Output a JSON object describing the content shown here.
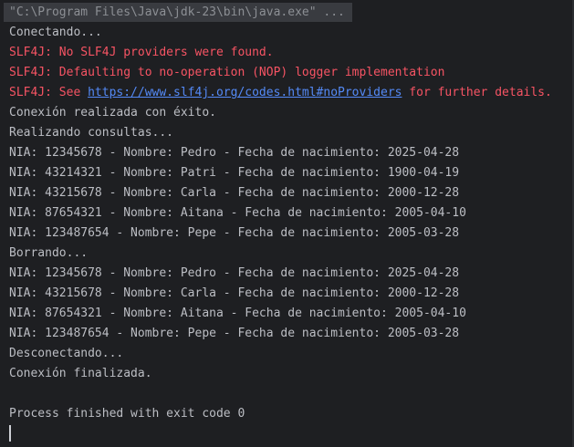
{
  "command": "\"C:\\Program Files\\Java\\jdk-23\\bin\\java.exe\" ...",
  "lines": {
    "connecting": "Conectando...",
    "slf4j_warn_1": "SLF4J: No SLF4J providers were found.",
    "slf4j_warn_2": "SLF4J: Defaulting to no-operation (NOP) logger implementation",
    "slf4j_see_prefix": "SLF4J: See ",
    "slf4j_link": "https://www.slf4j.org/codes.html#noProviders",
    "slf4j_see_suffix": " for further details.",
    "connected": "Conexión realizada con éxito.",
    "querying": "Realizando consultas...",
    "q1": "NIA: 12345678 - Nombre: Pedro - Fecha de nacimiento: 2025-04-28",
    "q2": "NIA: 43214321 - Nombre: Patri - Fecha de nacimiento: 1900-04-19",
    "q3": "NIA: 43215678 - Nombre: Carla - Fecha de nacimiento: 2000-12-28",
    "q4": "NIA: 87654321 - Nombre: Aitana - Fecha de nacimiento: 2005-04-10",
    "q5": "NIA: 123487654 - Nombre: Pepe - Fecha de nacimiento: 2005-03-28",
    "deleting": "Borrando...",
    "d1": "NIA: 12345678 - Nombre: Pedro - Fecha de nacimiento: 2025-04-28",
    "d2": "NIA: 43215678 - Nombre: Carla - Fecha de nacimiento: 2000-12-28",
    "d3": "NIA: 87654321 - Nombre: Aitana - Fecha de nacimiento: 2005-04-10",
    "d4": "NIA: 123487654 - Nombre: Pepe - Fecha de nacimiento: 2005-03-28",
    "disconnecting": "Desconectando...",
    "finished": "Conexión finalizada.",
    "exit": "Process finished with exit code 0"
  },
  "colors": {
    "background": "#1e1f22",
    "text": "#bcbec4",
    "error": "#f75464",
    "link": "#548af7",
    "command_bg": "#393b40"
  }
}
